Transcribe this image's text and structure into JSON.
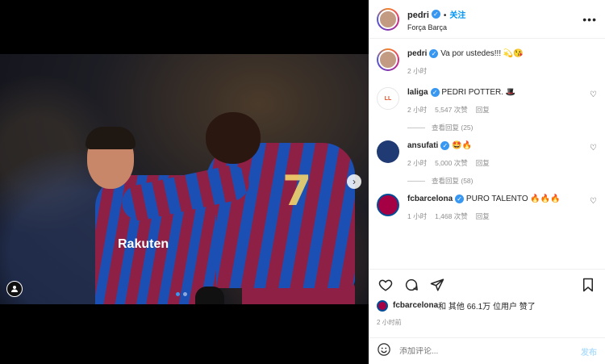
{
  "post": {
    "sponsor_text": "Rakuten",
    "jersey_text": "7",
    "user_tag_icon": "person-icon",
    "carousel_next_icon": "chevron-right-icon"
  },
  "header": {
    "username": "pedri",
    "follow_label": "关注",
    "location": "Força Barça"
  },
  "caption": {
    "username": "pedri",
    "text": "Va por ustedes!!! 💫😘",
    "time": "2 小时"
  },
  "comments": [
    {
      "username": "laliga",
      "text": "PEDRI POTTER. 🎩",
      "time": "2 小时",
      "likes": "5,547 次赞",
      "reply": "回复",
      "view_replies": "查看回复 (25)",
      "avatar_text": "LL"
    },
    {
      "username": "ansufati",
      "text": "🤩🔥",
      "time": "2 小时",
      "likes": "5,000 次赞",
      "reply": "回复",
      "view_replies": "查看回复 (58)",
      "avatar_text": ""
    },
    {
      "username": "fcbarcelona",
      "text": "PURO TALENTO 🔥🔥🔥",
      "time": "1 小时",
      "likes": "1,468 次赞",
      "reply": "回复",
      "avatar_text": "FCB"
    }
  ],
  "likes_summary": {
    "user": "fcbarcelona",
    "rest": " 和 其他 66.1万 位用户 赞了"
  },
  "post_time": "2 小时前",
  "comment_box": {
    "placeholder": "添加评论...",
    "post_label": "发布"
  },
  "colors": {
    "accent": "#0095f6",
    "verified": "#3897f0",
    "muted": "#8e8e8e"
  }
}
